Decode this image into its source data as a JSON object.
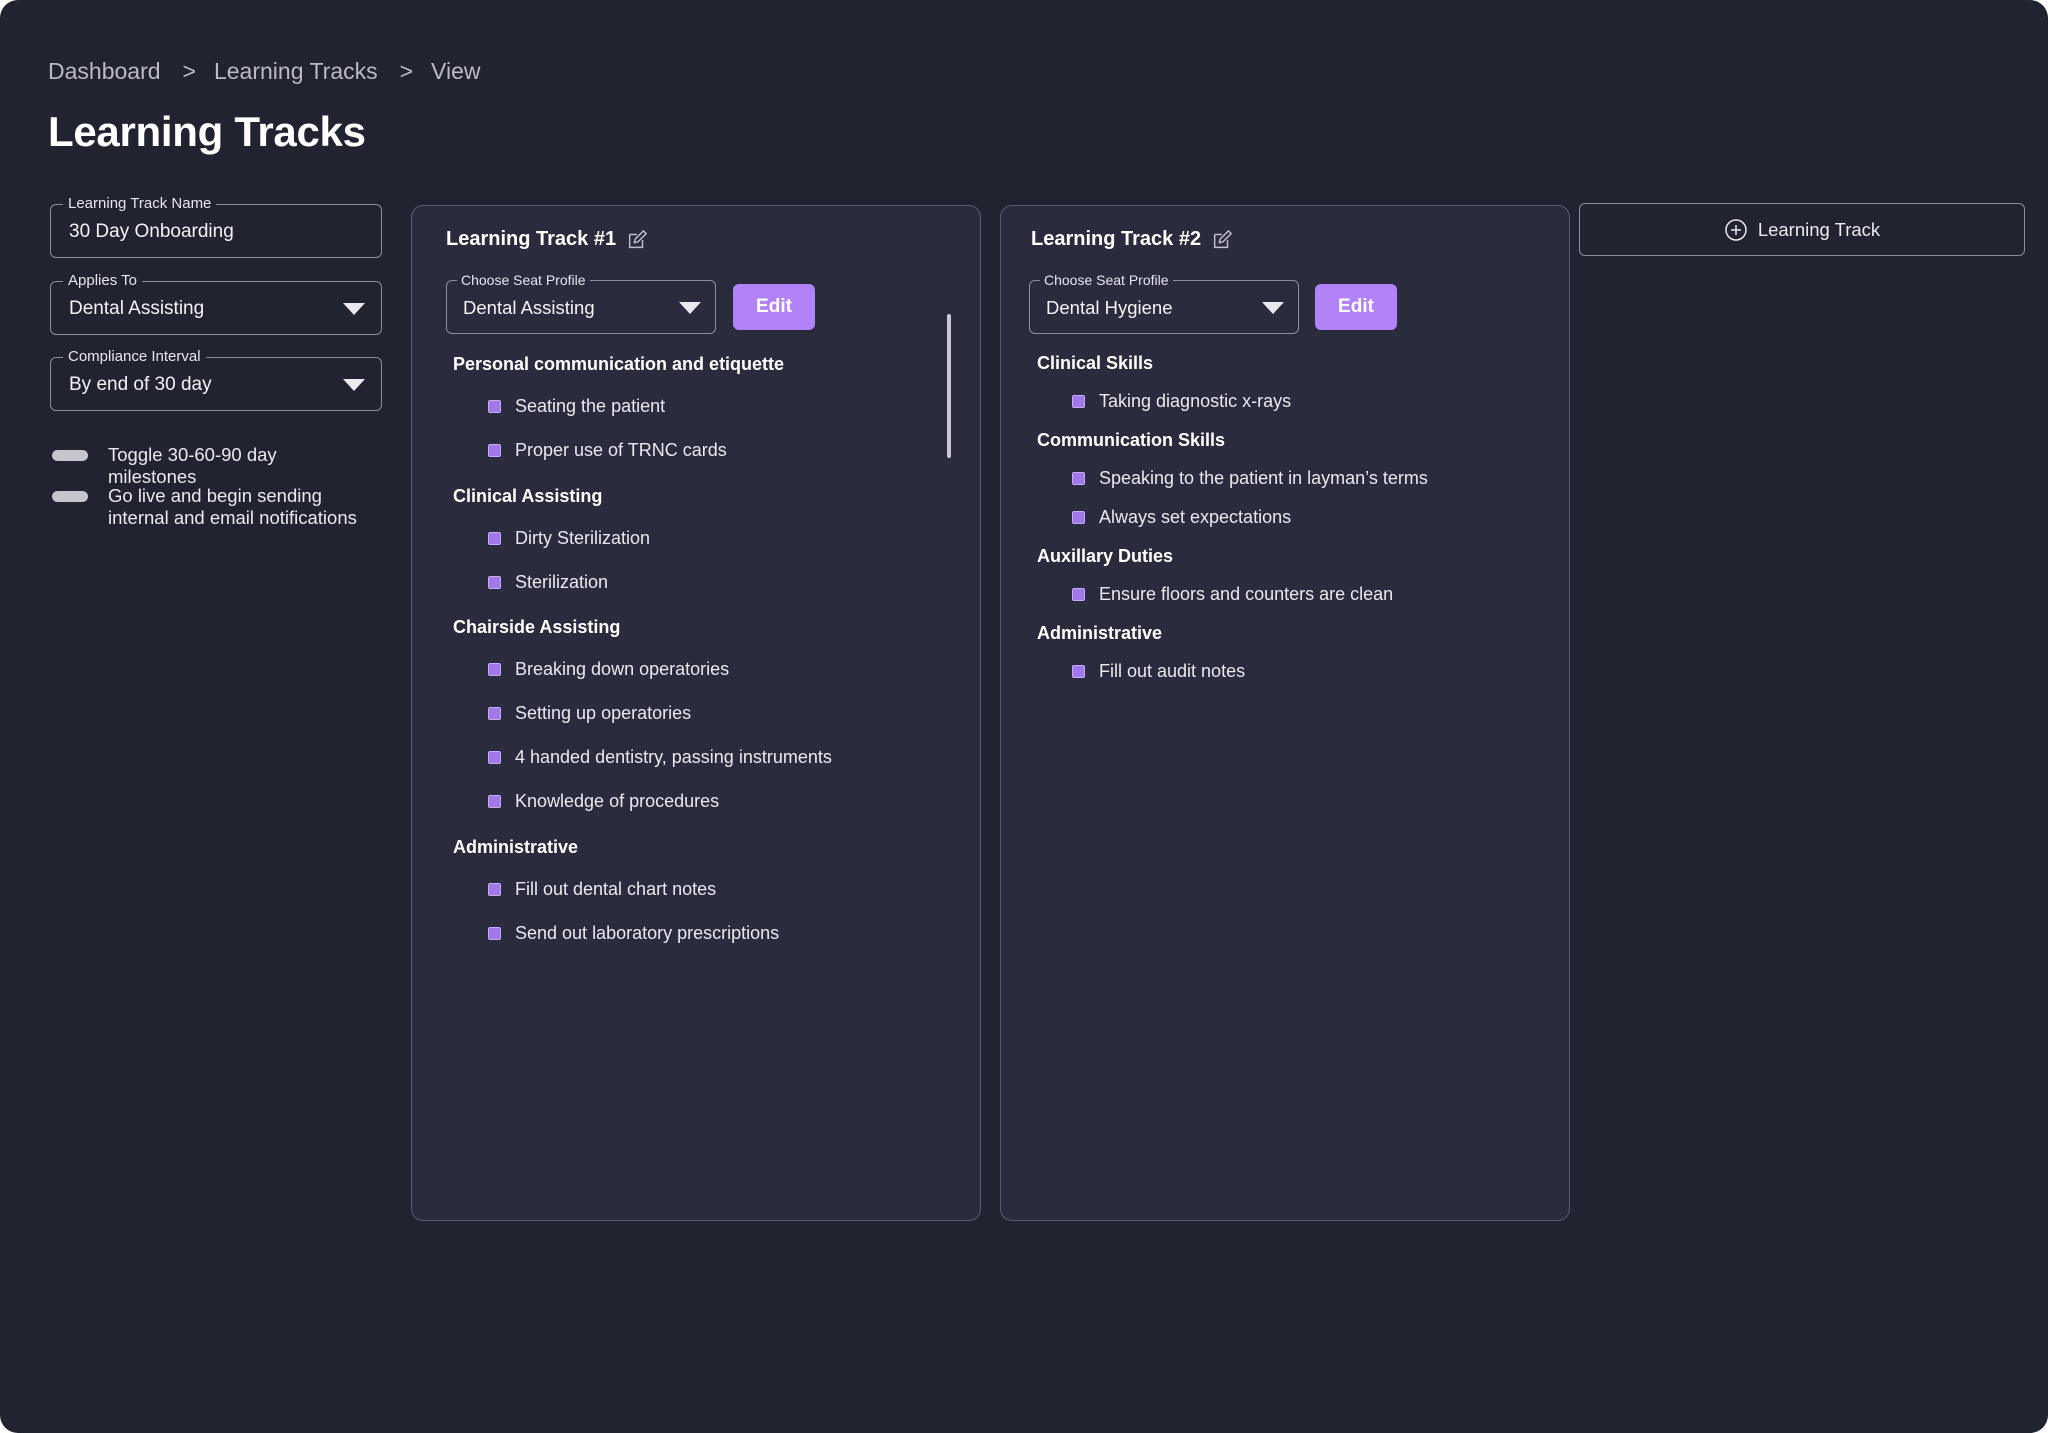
{
  "breadcrumb": {
    "items": [
      "Dashboard",
      "Learning Tracks",
      "View"
    ],
    "separator": ">"
  },
  "page_title": "Learning Tracks",
  "settings": {
    "track_name": {
      "legend": "Learning Track Name",
      "value": "30 Day Onboarding"
    },
    "applies_to": {
      "legend": "Applies To",
      "value": "Dental Assisting"
    },
    "compliance": {
      "legend": "Compliance Interval",
      "value": "By end of 30 day"
    },
    "toggles": [
      {
        "label": "Toggle 30-60-90 day milestones",
        "on": false
      },
      {
        "label": "Go live and begin sending internal and email notifications",
        "on": false
      }
    ]
  },
  "tracks": [
    {
      "title": "Learning Track #1",
      "seat_legend": "Choose Seat Profile",
      "seat_value": "Dental Assisting",
      "edit_label": "Edit",
      "sections": [
        {
          "title": "Personal communication and etiquette",
          "items": [
            "Seating the patient",
            "Proper use of TRNC cards"
          ]
        },
        {
          "title": "Clinical Assisting",
          "items": [
            "Dirty Sterilization",
            "Sterilization"
          ]
        },
        {
          "title": "Chairside Assisting",
          "items": [
            "Breaking down operatories",
            "Setting up operatories",
            "4 handed dentistry, passing instruments",
            "Knowledge of procedures"
          ]
        },
        {
          "title": "Administrative",
          "items": [
            "Fill out dental chart notes",
            "Send out laboratory prescriptions"
          ]
        }
      ]
    },
    {
      "title": "Learning Track #2",
      "seat_legend": "Choose Seat Profile",
      "seat_value": "Dental Hygiene",
      "edit_label": "Edit",
      "sections": [
        {
          "title": "Clinical Skills",
          "items": [
            "Taking diagnostic x-rays"
          ]
        },
        {
          "title": "Communication Skills",
          "items": [
            "Speaking to the patient in layman’s terms",
            "Always set expectations"
          ]
        },
        {
          "title": "Auxillary Duties",
          "items": [
            "Ensure floors and counters are clean"
          ]
        },
        {
          "title": "Administrative",
          "items": [
            "Fill out audit notes"
          ]
        }
      ]
    }
  ],
  "add_track_label": "Learning Track",
  "colors": {
    "background": "#222331",
    "panel": "#2a2b3d",
    "accent": "#b283f8",
    "checkbox": "#a078e8"
  }
}
